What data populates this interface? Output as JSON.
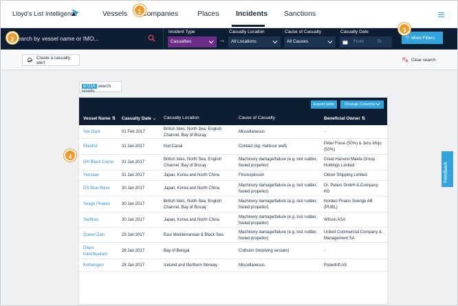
{
  "brand": {
    "name": "Lloyd's List Intelligence"
  },
  "nav": {
    "items": [
      {
        "id": "vessels",
        "label": "Vessels"
      },
      {
        "id": "companies",
        "label": "Companies"
      },
      {
        "id": "places",
        "label": "Places"
      },
      {
        "id": "incidents",
        "label": "Incidents",
        "active": true
      },
      {
        "id": "sanctions",
        "label": "Sanctions"
      }
    ]
  },
  "search": {
    "placeholder": "Search by vessel name or IMO..."
  },
  "filters": {
    "incident_type": {
      "label": "Incident Type",
      "value": "Casualties"
    },
    "casualty_location": {
      "label": "Casualty Location",
      "value": "All Locations"
    },
    "cause_of_casualty": {
      "label": "Cause of Casualty",
      "value": "All Causes"
    },
    "casualty_date": {
      "label": "Casualty Date",
      "from_placeholder": "From",
      "to_placeholder": "To"
    },
    "more_filters_label": "More Filters"
  },
  "actions": {
    "create_alert_label": "Create a casualty alert",
    "clear_search_label": "Clear search"
  },
  "results": {
    "count": "67210",
    "suffix": "search results"
  },
  "table": {
    "toolbar": {
      "export_label": "Export table",
      "columns_label": "Change Columns"
    },
    "columns": {
      "vessel": "Vessel Name",
      "date": "Casualty Date",
      "location": "Casualty Location",
      "cause": "Cause of Casualty",
      "owner": "Beneficial Owner"
    },
    "rows": [
      {
        "vessel": "Van Dijck",
        "date": "01 Feb 2017",
        "location": "British Isles, North Sea, English Channel, Bay of Biscay",
        "cause": "Miscellaneous",
        "owner": "-"
      },
      {
        "vessel": "Ellesllor",
        "date": "31 Jan 2017",
        "location": "Kiel Canal",
        "cause": "Contact (eg. Harbour wall)",
        "owner": "Peter Frese (50%) & Jens Mojo (50%)"
      },
      {
        "vessel": "GH Black Cayse",
        "date": "31 Jan 2017",
        "location": "British Isles, North Sea, English Channel, Bay of Biscay",
        "cause": "Machinery damage/failure (e.g. lost rudder, fouled propellor)",
        "owner": "Great Harvest Maeta Group Holdings Limited"
      },
      {
        "vessel": "Yeruslan",
        "date": "31 Jan 2017",
        "location": "Japan, Korea and North China",
        "cause": "Fire/explosion",
        "owner": "Oboer Shipping Limited"
      },
      {
        "vessel": "DS Blue Wave",
        "date": "30 Jan 2017",
        "location": "Japan, Korea and North China",
        "cause": "Machinery damage/failure (e.g. lost rudder, fouled propellor)",
        "owner": "Dr. Peters GmbH & Company KG"
      },
      {
        "vessel": "Seago Piraeus",
        "date": "30 Jan 2017",
        "location": "British Isles, North Sea, English Channel, Bay of Biscay",
        "cause": "Machinery damage/failure (e.g. lost rudder, fouled propellor)",
        "owner": "Nordeo Finans Sverige AB (PUBL)"
      },
      {
        "vessel": "Swiftnes",
        "date": "30 Jan 2017",
        "location": "Japan, Korea and North China",
        "cause": "Machinery damage/failure (e.g. lost rudder, fouled propellor)",
        "owner": "Wilson ASA"
      },
      {
        "vessel": "Queen Zain",
        "date": "29 Jan 2017",
        "location": "East Mediterranean & Black Sea",
        "cause": "Machinery damage/failure (e.g. lost rudder, fouled propellor)",
        "owner": "United Commercial Company & Management SA"
      },
      {
        "vessel": "Dilani Kanchipuram",
        "date": "28 Jan 2017",
        "location": "Bay of Bengal",
        "cause": "Collision (involving vessels)",
        "owner": "-"
      },
      {
        "vessel": "Kvitsengen",
        "date": "28 Jan 2017",
        "location": "Iceland and Northern Norway",
        "cause": "Miscellaneous",
        "owner": "Polardrift AS"
      }
    ]
  },
  "feedback": {
    "label": "Feedback"
  },
  "markers": [
    "1",
    "2",
    "3",
    "4"
  ],
  "colors": {
    "navy": "#0d1e33",
    "accent": "#33a3dc",
    "purple": "#6c2d86",
    "marker": "#f29a25"
  }
}
